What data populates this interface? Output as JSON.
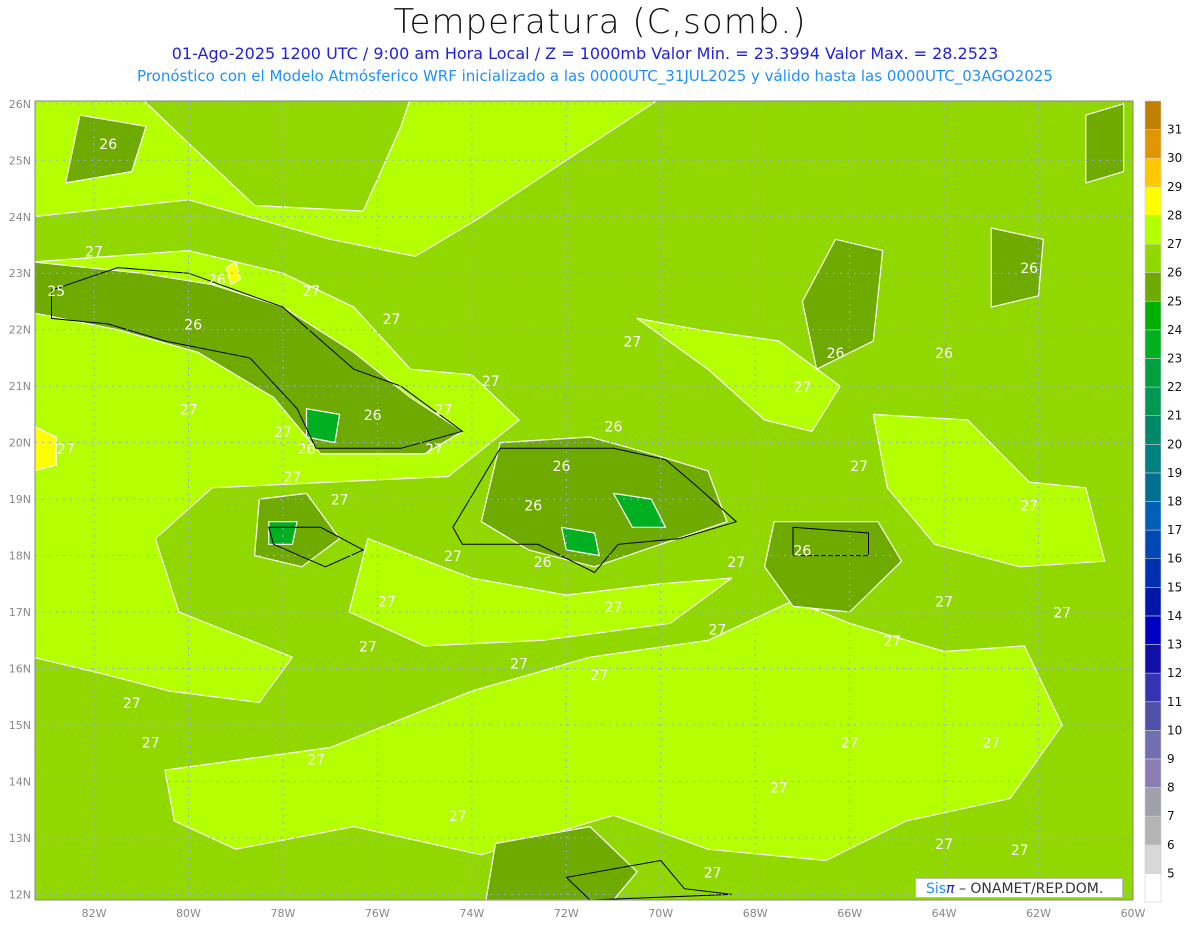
{
  "header": {
    "title": "Temperatura (C,somb.)",
    "subtitle_1": "01-Ago-2025  1200 UTC / 9:00 am Hora Local / Z = 1000mb   Valor Min. = 23.3994  Valor Max. = 28.2523",
    "subtitle_2": "Pronóstico con el Modelo Atmósferico WRF inicializado a las 0000UTC_31JUL2025 y válido hasta las  0000UTC_03AGO2025"
  },
  "map": {
    "lon_range": [
      -83.25,
      -60
    ],
    "lat_range": [
      11.9,
      26.05
    ],
    "lat_labels": [
      "12N",
      "13N",
      "14N",
      "15N",
      "16N",
      "17N",
      "18N",
      "19N",
      "20N",
      "21N",
      "22N",
      "23N",
      "24N",
      "25N",
      "26N"
    ],
    "lon_labels": [
      "82W",
      "80W",
      "78W",
      "76W",
      "74W",
      "72W",
      "70W",
      "68W",
      "66W",
      "64W",
      "62W",
      "60W"
    ],
    "contour_labels": [
      {
        "v": "26",
        "lon": -81.7,
        "lat": 25.2
      },
      {
        "v": "27",
        "lon": -82.0,
        "lat": 23.3
      },
      {
        "v": "25",
        "lon": -82.8,
        "lat": 22.6
      },
      {
        "v": "26",
        "lon": -79.9,
        "lat": 22.0
      },
      {
        "v": "26",
        "lon": -79.4,
        "lat": 22.8
      },
      {
        "v": "27",
        "lon": -77.4,
        "lat": 22.6
      },
      {
        "v": "27",
        "lon": -75.7,
        "lat": 22.1
      },
      {
        "v": "27",
        "lon": -80.0,
        "lat": 20.5
      },
      {
        "v": "27",
        "lon": -78.0,
        "lat": 20.1
      },
      {
        "v": "26",
        "lon": -77.5,
        "lat": 19.8
      },
      {
        "v": "26",
        "lon": -76.1,
        "lat": 20.4
      },
      {
        "v": "27",
        "lon": -74.6,
        "lat": 20.5
      },
      {
        "v": "27",
        "lon": -74.8,
        "lat": 19.8
      },
      {
        "v": "27",
        "lon": -77.8,
        "lat": 19.3
      },
      {
        "v": "27",
        "lon": -76.8,
        "lat": 18.9
      },
      {
        "v": "27",
        "lon": -73.6,
        "lat": 21.0
      },
      {
        "v": "27",
        "lon": -70.6,
        "lat": 21.7
      },
      {
        "v": "26",
        "lon": -71.0,
        "lat": 20.2
      },
      {
        "v": "26",
        "lon": -72.1,
        "lat": 19.5
      },
      {
        "v": "26",
        "lon": -72.7,
        "lat": 18.8
      },
      {
        "v": "26",
        "lon": -72.5,
        "lat": 17.8
      },
      {
        "v": "27",
        "lon": -74.4,
        "lat": 17.9
      },
      {
        "v": "27",
        "lon": -75.8,
        "lat": 17.1
      },
      {
        "v": "27",
        "lon": -71.0,
        "lat": 17.0
      },
      {
        "v": "27",
        "lon": -68.4,
        "lat": 17.8
      },
      {
        "v": "27",
        "lon": -68.8,
        "lat": 16.6
      },
      {
        "v": "26",
        "lon": -67.0,
        "lat": 18.0
      },
      {
        "v": "27",
        "lon": -67.0,
        "lat": 20.9
      },
      {
        "v": "26",
        "lon": -66.3,
        "lat": 21.5
      },
      {
        "v": "27",
        "lon": -65.8,
        "lat": 19.5
      },
      {
        "v": "26",
        "lon": -64.0,
        "lat": 21.5
      },
      {
        "v": "26",
        "lon": -62.2,
        "lat": 23.0
      },
      {
        "v": "27",
        "lon": -62.2,
        "lat": 18.8
      },
      {
        "v": "27",
        "lon": -64.0,
        "lat": 17.1
      },
      {
        "v": "27",
        "lon": -61.5,
        "lat": 16.9
      },
      {
        "v": "27",
        "lon": -65.1,
        "lat": 16.4
      },
      {
        "v": "27",
        "lon": -76.2,
        "lat": 16.3
      },
      {
        "v": "27",
        "lon": -73.0,
        "lat": 16.0
      },
      {
        "v": "27",
        "lon": -71.3,
        "lat": 15.8
      },
      {
        "v": "27",
        "lon": -81.2,
        "lat": 15.3
      },
      {
        "v": "27",
        "lon": -80.8,
        "lat": 14.6
      },
      {
        "v": "27",
        "lon": -77.3,
        "lat": 14.3
      },
      {
        "v": "27",
        "lon": -66.0,
        "lat": 14.6
      },
      {
        "v": "27",
        "lon": -67.5,
        "lat": 13.8
      },
      {
        "v": "27",
        "lon": -74.3,
        "lat": 13.3
      },
      {
        "v": "27",
        "lon": -63.0,
        "lat": 14.6
      },
      {
        "v": "27",
        "lon": -64.0,
        "lat": 12.8
      },
      {
        "v": "27",
        "lon": -62.4,
        "lat": 12.7
      },
      {
        "v": "27",
        "lon": -68.9,
        "lat": 12.3
      },
      {
        "v": "27",
        "lon": -82.6,
        "lat": 19.8
      }
    ]
  },
  "colorbar": {
    "labels": [
      "5",
      "6",
      "7",
      "8",
      "9",
      "10",
      "11",
      "12",
      "13",
      "14",
      "15",
      "16",
      "17",
      "18",
      "19",
      "20",
      "21",
      "22",
      "23",
      "24",
      "25",
      "26",
      "27",
      "28",
      "29",
      "30",
      "31"
    ],
    "colors": [
      "#ffffff",
      "#d8d8d8",
      "#b4b4b4",
      "#a0a0aa",
      "#8c7cb4",
      "#7070b0",
      "#5050a8",
      "#3434b0",
      "#1010a8",
      "#0000c4",
      "#0018a8",
      "#0030b0",
      "#0048b4",
      "#0060b8",
      "#007090",
      "#008080",
      "#008868",
      "#009850",
      "#00a040",
      "#00b020",
      "#00b000",
      "#6eaa00",
      "#90d800",
      "#b4ff00",
      "#ffff00",
      "#ffc800",
      "#e09600",
      "#c08000"
    ]
  },
  "credit": {
    "sis": "Sis",
    "pi": "π",
    "rest": " – ONAMET/REP.DOM."
  }
}
